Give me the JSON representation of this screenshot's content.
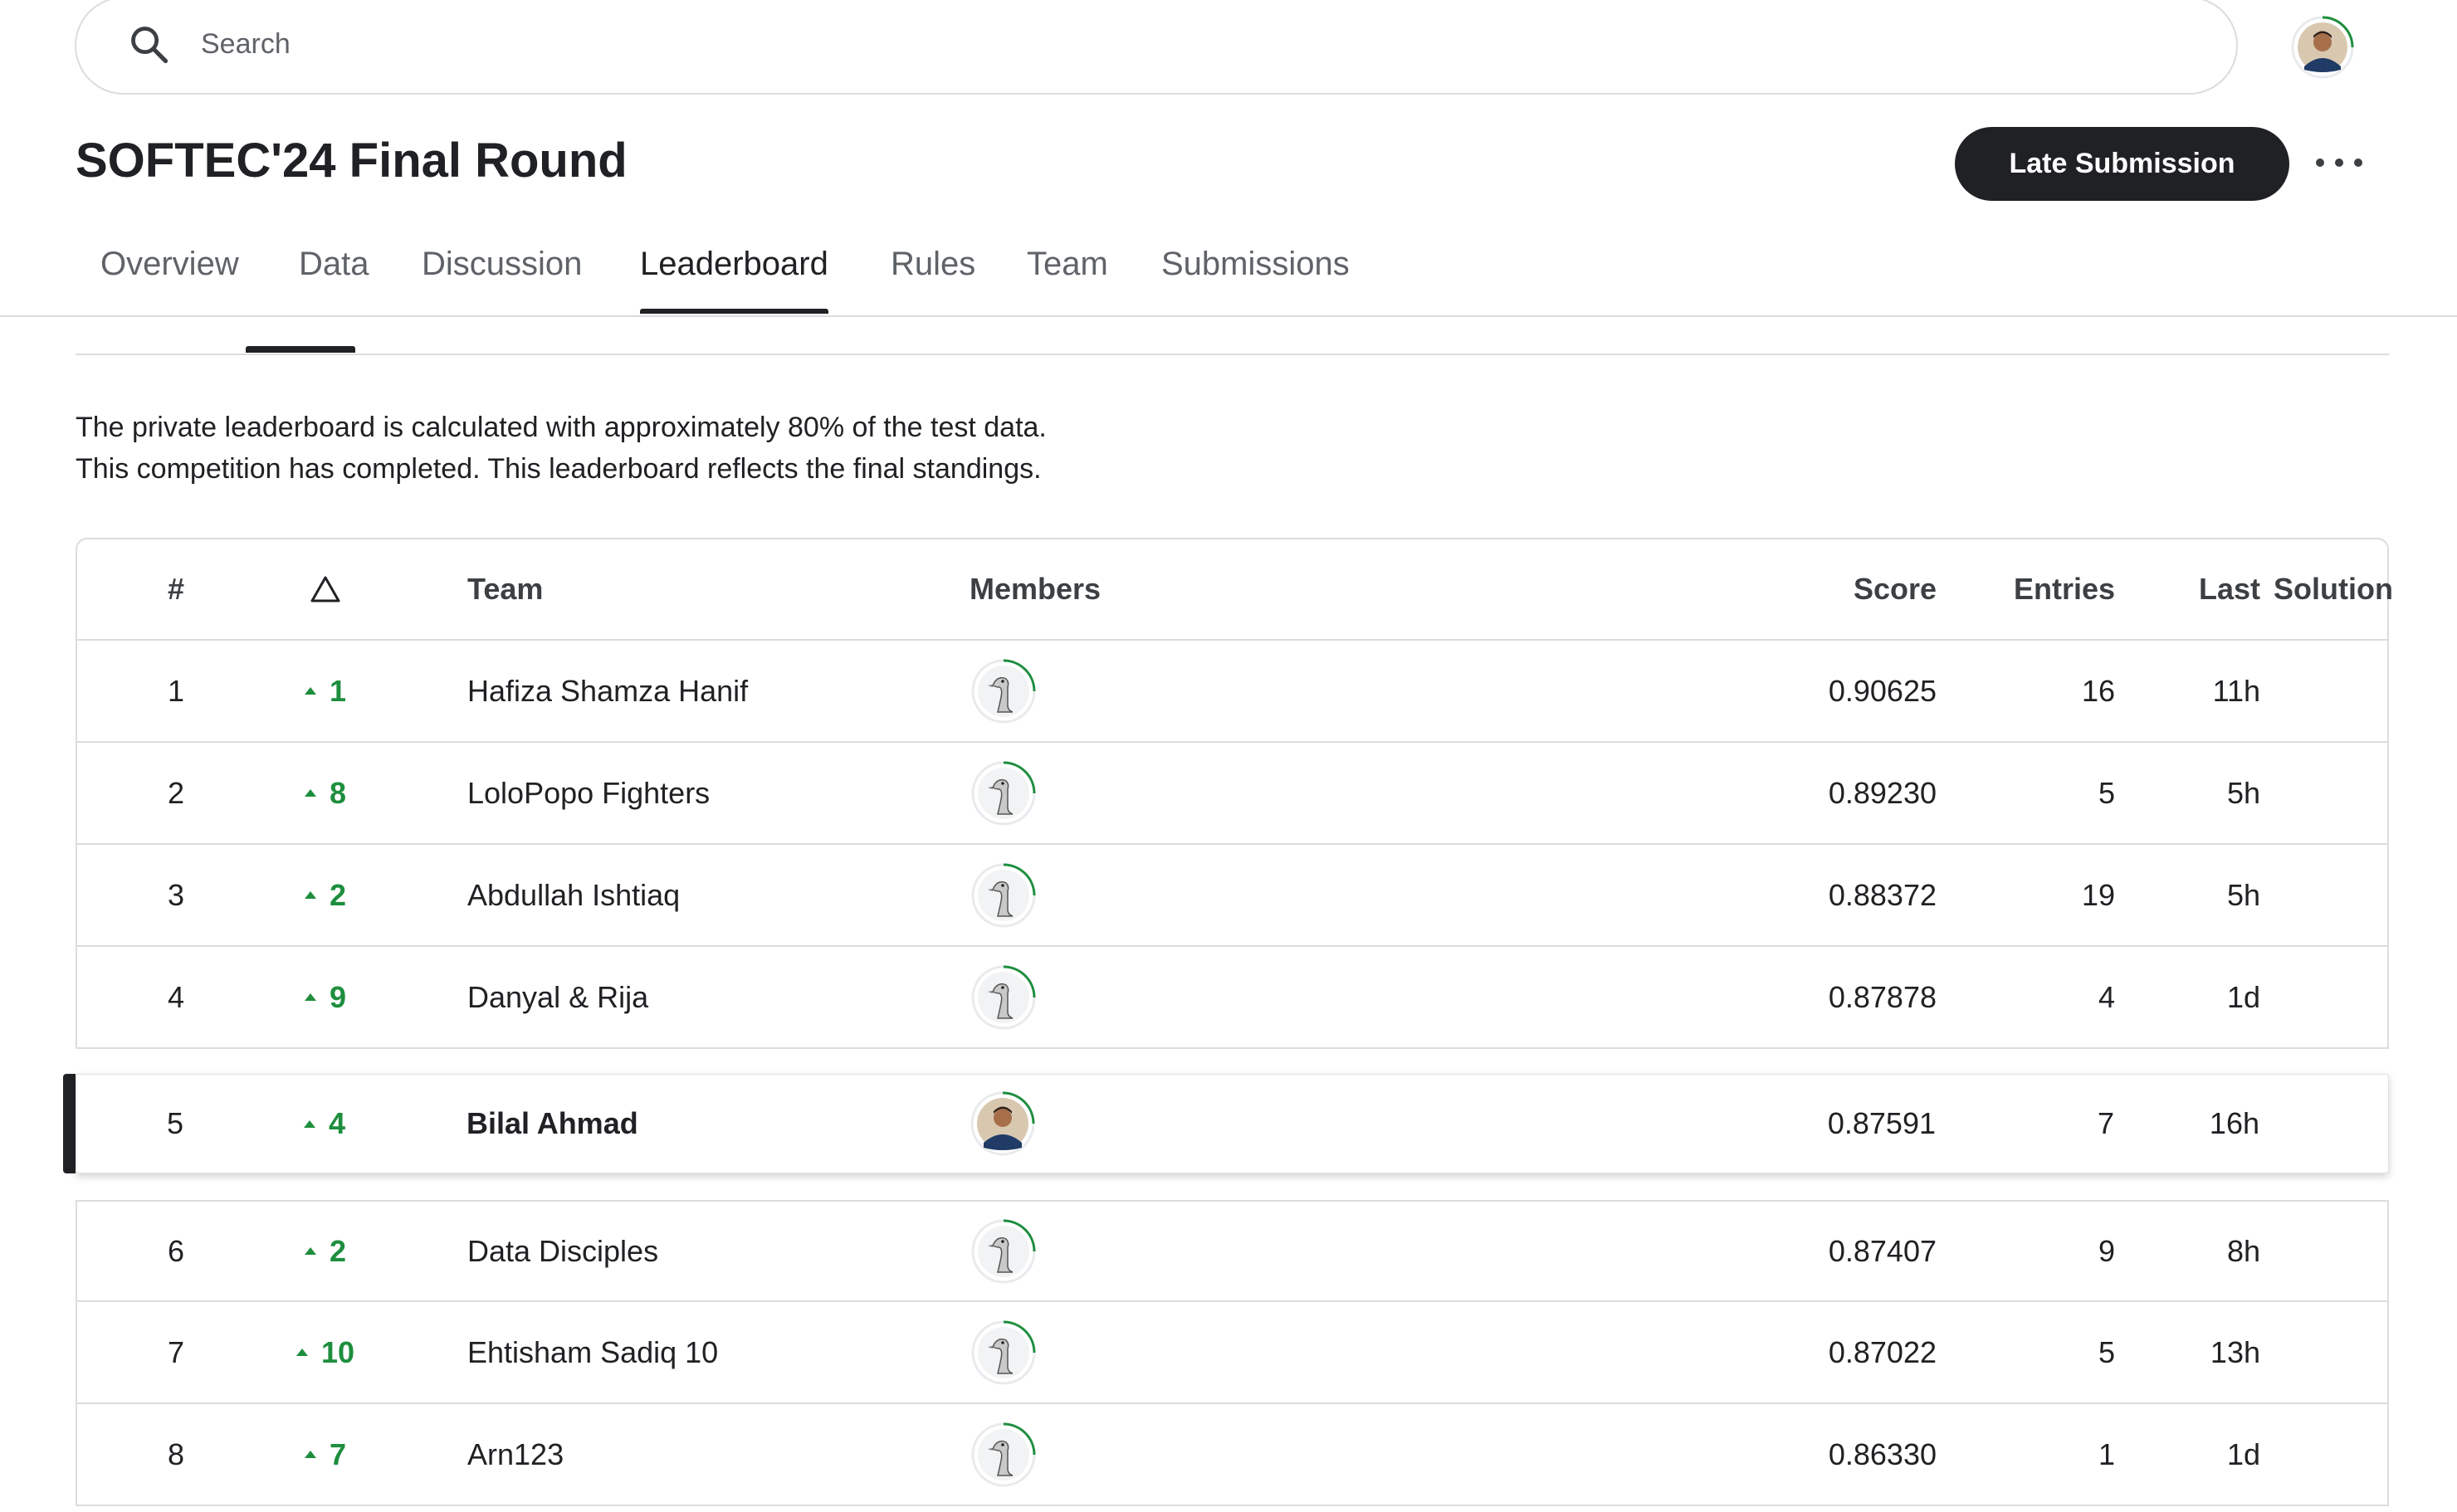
{
  "search": {
    "placeholder": "Search"
  },
  "header": {
    "title": "SOFTEC'24 Final Round",
    "late_submission_label": "Late Submission"
  },
  "tabs": [
    {
      "label": "Overview"
    },
    {
      "label": "Data"
    },
    {
      "label": "Discussion"
    },
    {
      "label": "Leaderboard",
      "active": true
    },
    {
      "label": "Rules"
    },
    {
      "label": "Team"
    },
    {
      "label": "Submissions"
    }
  ],
  "info": {
    "line1": "The private leaderboard is calculated with approximately 80% of the test data.",
    "line2": "This competition has completed. This leaderboard reflects the final standings."
  },
  "table": {
    "headers": {
      "rank": "#",
      "team": "Team",
      "members": "Members",
      "score": "Score",
      "entries": "Entries",
      "last": "Last",
      "solution": "Solution"
    },
    "rows": [
      {
        "rank": "1",
        "delta": "1",
        "team": "Hafiza Shamza Hanif",
        "score": "0.90625",
        "entries": "16",
        "last": "11h"
      },
      {
        "rank": "2",
        "delta": "8",
        "team": "LoloPopo Fighters",
        "score": "0.89230",
        "entries": "5",
        "last": "5h"
      },
      {
        "rank": "3",
        "delta": "2",
        "team": "Abdullah Ishtiaq",
        "score": "0.88372",
        "entries": "19",
        "last": "5h"
      },
      {
        "rank": "4",
        "delta": "9",
        "team": "Danyal & Rija",
        "score": "0.87878",
        "entries": "4",
        "last": "1d"
      },
      {
        "rank": "5",
        "delta": "4",
        "team": "Bilal Ahmad",
        "score": "0.87591",
        "entries": "7",
        "last": "16h"
      },
      {
        "rank": "6",
        "delta": "2",
        "team": "Data Disciples",
        "score": "0.87407",
        "entries": "9",
        "last": "8h"
      },
      {
        "rank": "7",
        "delta": "10",
        "team": "Ehtisham Sadiq 10",
        "score": "0.87022",
        "entries": "5",
        "last": "13h"
      },
      {
        "rank": "8",
        "delta": "7",
        "team": "Arn123",
        "score": "0.86330",
        "entries": "1",
        "last": "1d"
      }
    ]
  },
  "colors": {
    "accent_green": "#1e8e3e",
    "dark": "#202124",
    "border": "#dadce0"
  },
  "icons": {
    "search": "search-icon",
    "more": "more-horizontal-icon",
    "delta_up": "triangle-up-icon"
  }
}
